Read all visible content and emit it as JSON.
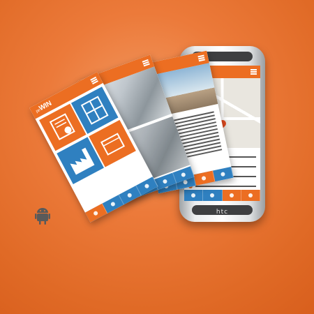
{
  "app": {
    "logo_text": "WIN",
    "logo_prefix": "pe",
    "brand_label": "htc"
  },
  "colors": {
    "background": "#e8742f",
    "accent_orange": "#ec6e22",
    "tile_blue": "#2f80c0"
  },
  "icons": {
    "platform": "android-icon"
  },
  "tabs": {
    "count": 4
  }
}
